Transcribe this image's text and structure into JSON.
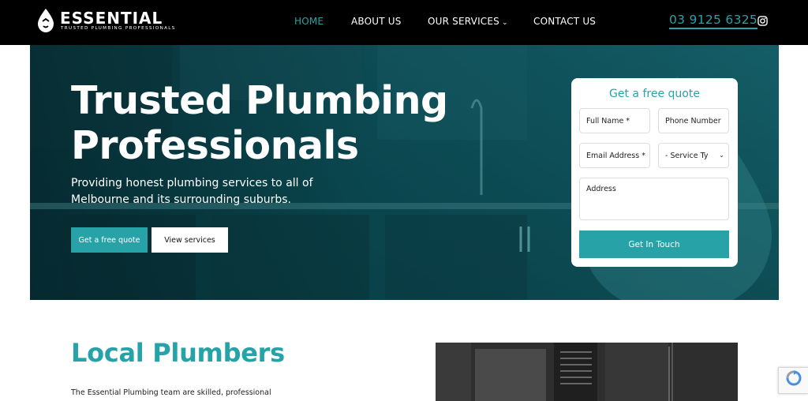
{
  "header": {
    "logo": {
      "name": "ESSENTIAL",
      "tagline": "TRUSTED PLUMBING PROFESSIONALS",
      "icon": "water-drop-icon"
    },
    "nav": [
      {
        "label": "HOME",
        "active": true
      },
      {
        "label": "ABOUT US",
        "active": false
      },
      {
        "label": "OUR SERVICES",
        "active": false,
        "dropdown": true
      },
      {
        "label": "CONTACT US",
        "active": false
      }
    ],
    "phone": "03 9125 6325",
    "social_icon": "instagram-icon"
  },
  "hero": {
    "title": "Trusted Plumbing Professionals",
    "subtitle": "Providing honest plumbing services to all of Melbourne and its surrounding suburbs.",
    "primary_button": "Get a free quote",
    "secondary_button": "View services"
  },
  "quote_form": {
    "title": "Get a free quote",
    "full_name_placeholder": "Full Name *",
    "phone_placeholder": "Phone Number",
    "email_placeholder": "Email Address *",
    "service_select": "- Service Ty",
    "address_placeholder": "Address",
    "submit_label": "Get In Touch"
  },
  "local_section": {
    "title": "Local Plumbers",
    "text": "The Essential Plumbing team are skilled, professional"
  },
  "colors": {
    "accent": "#26a3a8",
    "header_bg": "#000000",
    "hero_overlay": "#0b4a52"
  }
}
